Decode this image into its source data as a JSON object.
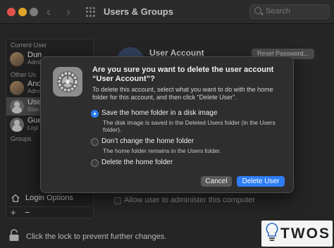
{
  "window": {
    "title": "Users & Groups"
  },
  "search": {
    "placeholder": "Search"
  },
  "sidebar": {
    "current_user_heading": "Current User",
    "current_user": {
      "name": "Dun",
      "role": "Admi"
    },
    "other_users_heading": "Other Us",
    "users": [
      {
        "name": "Andi",
        "role": "Admi"
      },
      {
        "name": "User",
        "role": "Stan"
      },
      {
        "name": "Gue",
        "role": "Logi"
      }
    ],
    "groups_heading": "Groups",
    "login_options": "Login Options",
    "add_label": "+",
    "remove_label": "−"
  },
  "main": {
    "user_name_partial": "User Account",
    "reset_password_label": "Reset Password...",
    "allow_admin_label": "Allow user to administer this computer"
  },
  "lock": {
    "text": "Click the lock to prevent further changes."
  },
  "dialog": {
    "title": "Are you sure you want to delete the user account “User Account”?",
    "description": "To delete this account, select what you want to do with the home folder for this account, and then click “Delete User”.",
    "options": [
      {
        "label": "Save the home folder in a disk image",
        "desc": "The disk image is saved in the Deleted Users folder (in the Users folder).",
        "selected": true
      },
      {
        "label": "Don’t change the home folder",
        "desc": "The home folder remains in the Users folder.",
        "selected": false
      },
      {
        "label": "Delete the home folder",
        "desc": "",
        "selected": false
      }
    ],
    "cancel_label": "Cancel",
    "delete_label": "Delete User"
  },
  "watermark": {
    "text": "TWOS"
  },
  "colors": {
    "accent": "#2e7df6",
    "window_bg": "#2b2b2b",
    "sheet_bg": "#2e2e2e"
  }
}
